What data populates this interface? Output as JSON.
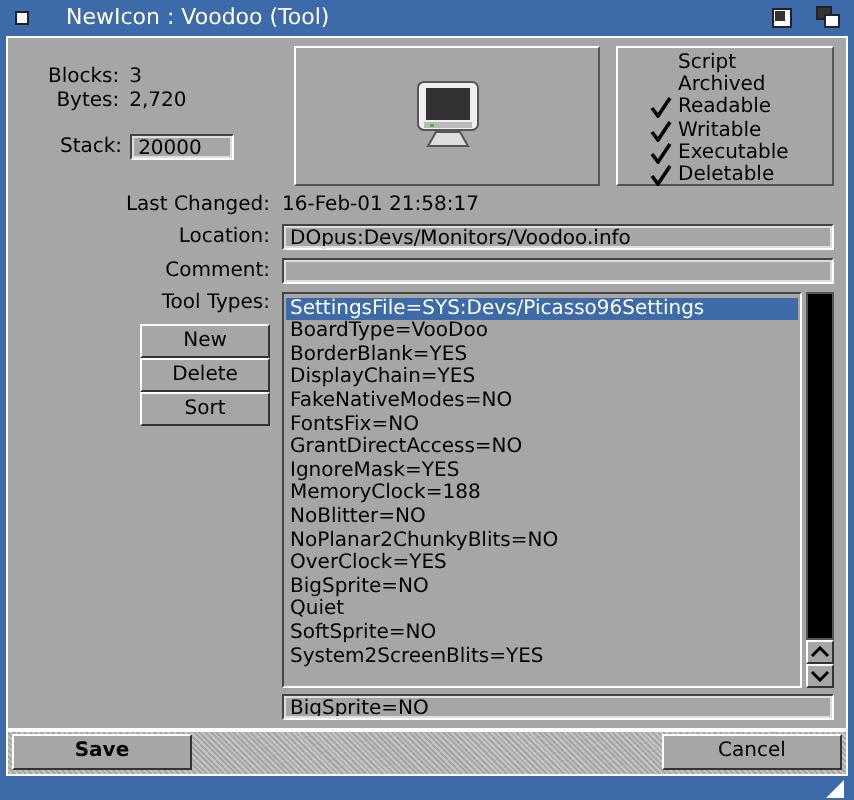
{
  "window": {
    "title": "NewIcon : Voodoo (Tool)"
  },
  "info": [
    {
      "label": "Blocks:",
      "value": "3"
    },
    {
      "label": "Bytes:",
      "value": "2,720"
    }
  ],
  "stack": {
    "label": "Stack:",
    "value": "20000"
  },
  "protection": [
    {
      "label": "Script",
      "checked": false
    },
    {
      "label": "Archived",
      "checked": false
    },
    {
      "label": "Readable",
      "checked": true
    },
    {
      "label": "Writable",
      "checked": true
    },
    {
      "label": "Executable",
      "checked": true
    },
    {
      "label": "Deletable",
      "checked": true
    }
  ],
  "last_changed": {
    "label": "Last Changed:",
    "value": "16-Feb-01 21:58:17"
  },
  "location": {
    "label": "Location:",
    "value": "DOpus:Devs/Monitors/Voodoo.info"
  },
  "comment": {
    "label": "Comment:"
  },
  "tool_types": {
    "label": "Tool Types:",
    "buttons": [
      "New",
      "Delete",
      "Sort"
    ],
    "items": [
      {
        "text": "SettingsFile=SYS:Devs/Picasso96Settings",
        "selected": true
      },
      {
        "text": "BoardType=VooDoo",
        "selected": false
      },
      {
        "text": "BorderBlank=YES",
        "selected": false
      },
      {
        "text": "DisplayChain=YES",
        "selected": false
      },
      {
        "text": "FakeNativeModes=NO",
        "selected": false
      },
      {
        "text": "FontsFix=NO",
        "selected": false
      },
      {
        "text": "GrantDirectAccess=NO",
        "selected": false
      },
      {
        "text": "IgnoreMask=YES",
        "selected": false
      },
      {
        "text": "MemoryClock=188",
        "selected": false
      },
      {
        "text": "NoBlitter=NO",
        "selected": false
      },
      {
        "text": "NoPlanar2ChunkyBlits=NO",
        "selected": false
      },
      {
        "text": "OverClock=YES",
        "selected": false
      },
      {
        "text": "BigSprite=NO",
        "selected": false
      },
      {
        "text": "Quiet",
        "selected": false
      },
      {
        "text": "SoftSprite=NO",
        "selected": false
      },
      {
        "text": "System2ScreenBlits=YES",
        "selected": false
      }
    ],
    "edit_value": "BigSprite=NO"
  },
  "buttons": [
    "Save",
    "Cancel"
  ]
}
